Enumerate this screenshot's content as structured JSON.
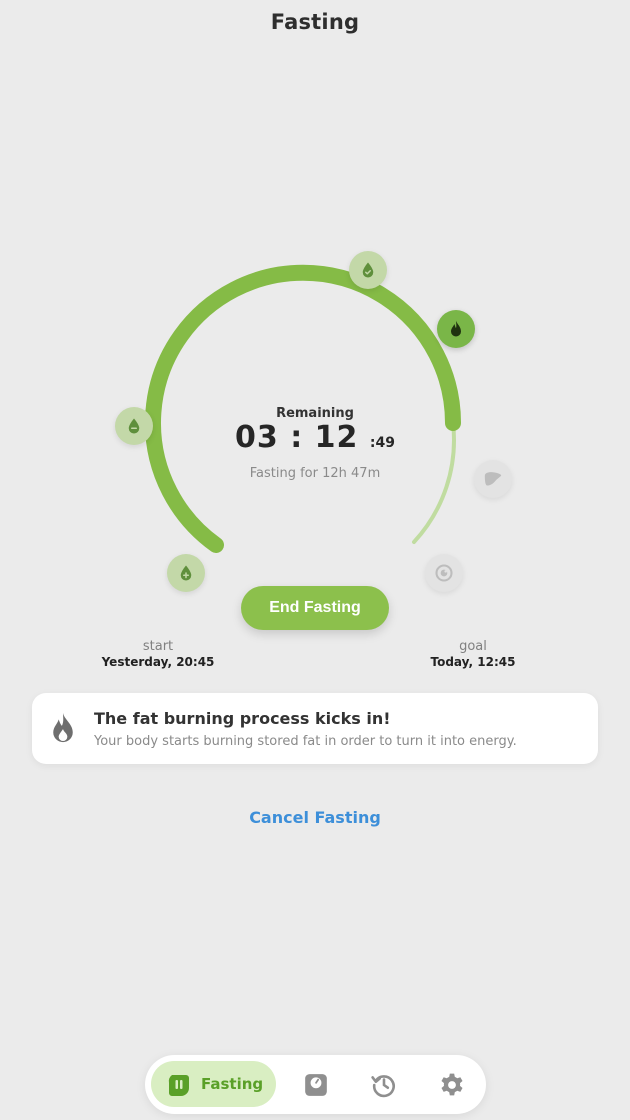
{
  "header": {
    "title": "Fasting"
  },
  "timer": {
    "remaining_label": "Remaining",
    "hours": "03",
    "separator": ":",
    "minutes": "12",
    "seconds": ":49",
    "fasting_for": "Fasting for 12h 47m",
    "progress_fraction": 0.8
  },
  "stages": [
    {
      "name": "blood-sugar-rises",
      "icon": "drop-plus-icon",
      "state": "done"
    },
    {
      "name": "blood-sugar-drops",
      "icon": "drop-minus-icon",
      "state": "done"
    },
    {
      "name": "blood-sugar-normal",
      "icon": "drop-check-icon",
      "state": "done"
    },
    {
      "name": "fat-burning",
      "icon": "flame-icon",
      "state": "current"
    },
    {
      "name": "liver",
      "icon": "liver-icon",
      "state": "future"
    },
    {
      "name": "autophagy",
      "icon": "cell-icon",
      "state": "future"
    }
  ],
  "actions": {
    "end_fasting": "End Fasting",
    "cancel_fasting": "Cancel Fasting"
  },
  "start": {
    "label": "start",
    "value": "Yesterday, 20:45"
  },
  "goal": {
    "label": "goal",
    "value": "Today, 12:45"
  },
  "info_card": {
    "icon": "flame-icon",
    "title": "The fat burning process kicks in!",
    "description": "Your body starts burning stored fat in order to turn it into energy."
  },
  "tabbar": {
    "tabs": [
      {
        "label": "Fasting",
        "icon": "fasting-icon",
        "active": true
      },
      {
        "label": "",
        "icon": "scale-icon",
        "active": false
      },
      {
        "label": "",
        "icon": "history-icon",
        "active": false
      },
      {
        "label": "",
        "icon": "settings-icon",
        "active": false
      }
    ]
  },
  "colors": {
    "accent": "#8cc04c",
    "ring_progress": "#85bb46",
    "ring_remaining": "#c0dca0",
    "link": "#3d8fd9",
    "background": "#ebebeb"
  }
}
